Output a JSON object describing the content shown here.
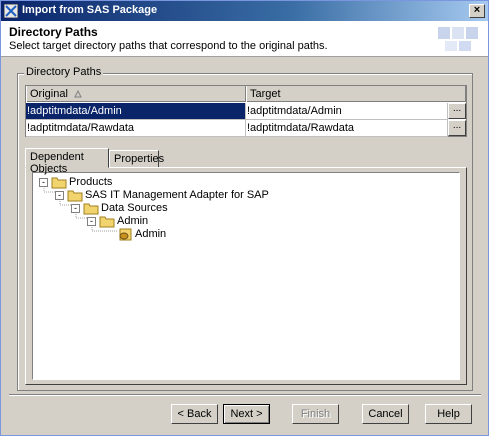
{
  "window": {
    "title": "Import from SAS Package"
  },
  "header": {
    "title": "Directory Paths",
    "subtitle": "Select target directory paths that correspond to the original paths."
  },
  "group": {
    "legend": "Directory Paths"
  },
  "table": {
    "columns": [
      "Original",
      "Target"
    ],
    "rows": [
      {
        "original": "!adptitmdata/Admin",
        "target": "!adptitmdata/Admin",
        "browse": "..."
      },
      {
        "original": "!adptitmdata/Rawdata",
        "target": "!adptitmdata/Rawdata",
        "browse": "..."
      }
    ]
  },
  "tabs": [
    "Dependent Objects",
    "Properties"
  ],
  "tree": {
    "nodes": [
      {
        "label": "Products",
        "toggle": "-"
      },
      {
        "label": "SAS IT Management Adapter for SAP",
        "toggle": "-"
      },
      {
        "label": "Data Sources",
        "toggle": "-"
      },
      {
        "label": "Admin",
        "toggle": "-"
      },
      {
        "label": "Admin",
        "toggle": ""
      }
    ]
  },
  "buttons": {
    "back": "< Back",
    "next": "Next >",
    "finish": "Finish",
    "cancel": "Cancel",
    "help": "Help"
  },
  "colors": {
    "selection": "#0a246a",
    "folder": "#f2d46e",
    "dialog_bg": "#d4d0c8"
  }
}
